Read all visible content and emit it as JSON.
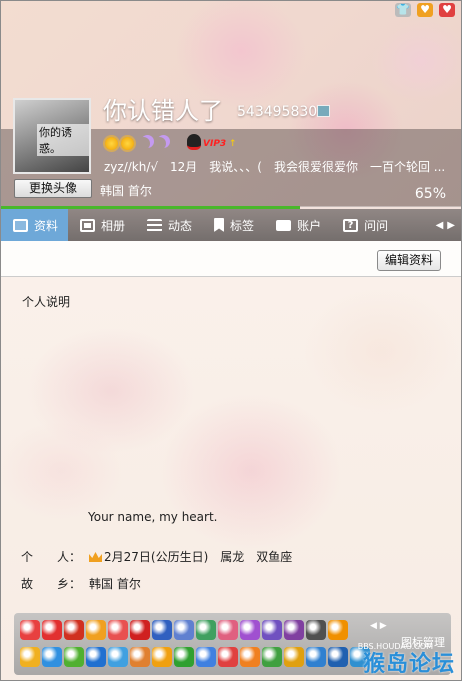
{
  "profile": {
    "nickname": "你认错人了",
    "qq_number": "543495830",
    "avatar_text": "你的诱惑。",
    "change_avatar_label": "更换头像",
    "vip_label": "VIP3",
    "status_text": "zyz//kh/√　12月　我说、、、(　我会很爱很爱你　一百个轮回 ...",
    "location": "韩国 首尔",
    "completion_text": "65%",
    "completion_fraction": 0.65
  },
  "tabs": [
    {
      "label": "资料",
      "icon": "profile-card-icon",
      "active": true
    },
    {
      "label": "相册",
      "icon": "photo-album-icon",
      "active": false
    },
    {
      "label": "动态",
      "icon": "feed-list-icon",
      "active": false
    },
    {
      "label": "标签",
      "icon": "bookmark-tag-icon",
      "active": false
    },
    {
      "label": "账户",
      "icon": "briefcase-icon",
      "active": false
    },
    {
      "label": "问问",
      "icon": "question-icon",
      "active": false
    }
  ],
  "content": {
    "edit_button_label": "编辑资料",
    "personal_note_label": "个人说明",
    "signature": "Your name, my heart.",
    "fields": [
      {
        "label": "个　　人：",
        "value": "2月27日(公历生日)　属龙　双鱼座"
      },
      {
        "label": "故　　乡：",
        "value": "韩国 首尔"
      }
    ]
  },
  "iconbar": {
    "manage_label": "图标管理",
    "row1_colors": [
      "#e84040",
      "#e23030",
      "#d03020",
      "#f0a020",
      "#e85050",
      "#d02020",
      "#3060c0",
      "#6080d0",
      "#40a060",
      "#e06080",
      "#a050d0",
      "#7050c0",
      "#8040a0",
      "#505050",
      "#f09000"
    ],
    "row2_colors": [
      "#f0b020",
      "#3090e0",
      "#50b030",
      "#2070d0",
      "#40a0e0",
      "#e08030",
      "#f0a010",
      "#30a030",
      "#4080e0",
      "#e04040",
      "#f08020",
      "#40a040",
      "#e0a010",
      "#3080d0",
      "#2060b0",
      "#3090d0"
    ]
  },
  "watermark": {
    "main": "猴岛论坛",
    "sub": "BBS.HOUDAO.COM"
  },
  "colors": {
    "accent_tab": "#6ea8d8",
    "progress": "#49b82b",
    "vip": "#ff2020"
  }
}
